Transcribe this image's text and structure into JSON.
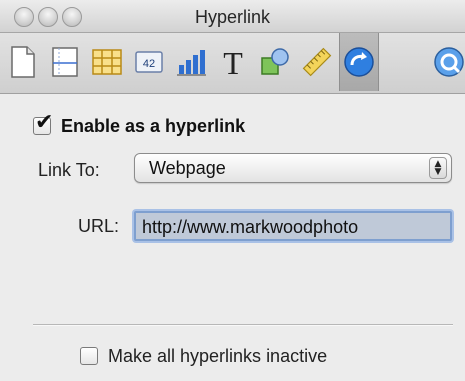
{
  "window": {
    "title": "Hyperlink"
  },
  "toolbar": {
    "items": [
      {
        "name": "document-inspector-icon",
        "selected": false
      },
      {
        "name": "layout-inspector-icon",
        "selected": false
      },
      {
        "name": "table-inspector-icon",
        "selected": false
      },
      {
        "name": "format-inspector-icon",
        "label": "42",
        "selected": false
      },
      {
        "name": "chart-inspector-icon",
        "selected": false
      },
      {
        "name": "text-inspector-icon",
        "label": "T",
        "selected": false
      },
      {
        "name": "graphic-inspector-icon",
        "selected": false
      },
      {
        "name": "metrics-inspector-icon",
        "selected": false
      },
      {
        "name": "hyperlink-inspector-icon",
        "selected": true
      },
      {
        "name": "quicktime-inspector-icon",
        "selected": false
      }
    ]
  },
  "hyperlink": {
    "enable_checked": true,
    "enable_label": "Enable as a hyperlink",
    "link_to_label": "Link To:",
    "link_to_value": "Webpage",
    "url_label": "URL:",
    "url_value": "http://www.markwoodphoto",
    "inactive_checked": false,
    "inactive_label": "Make all hyperlinks inactive"
  },
  "colors": {
    "selection_blue": "#7e9fcf",
    "url_field_bg": "#bfc9d8",
    "hyperlink_icon_blue": "#2f7fe0"
  }
}
